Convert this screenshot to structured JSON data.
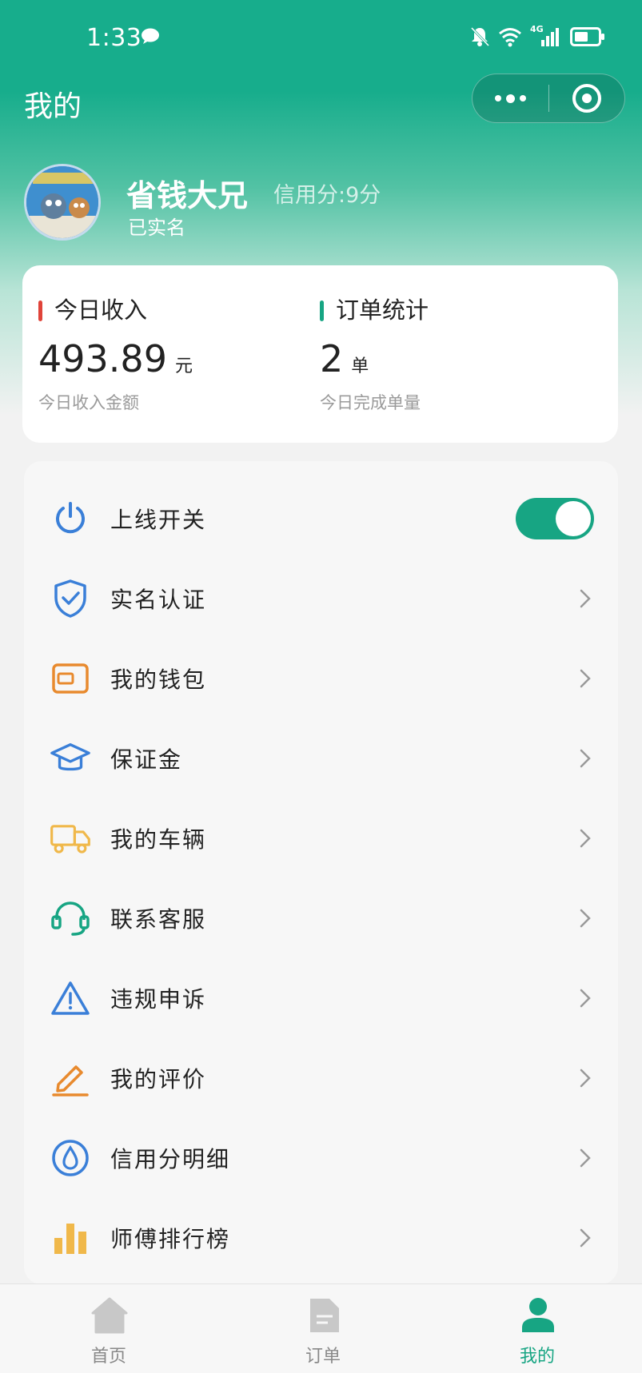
{
  "status_bar": {
    "time": "1:33",
    "network": "4G"
  },
  "nav": {
    "title": "我的"
  },
  "user": {
    "name": "省钱大兄",
    "credit": "信用分:9分",
    "status": "已实名"
  },
  "stats": {
    "income": {
      "title": "今日收入",
      "value": "493.89",
      "unit": "元",
      "sub": "今日收入金额",
      "bar_color": "#e0443a"
    },
    "orders": {
      "title": "订单统计",
      "value": "2",
      "unit": "单",
      "sub": "今日完成单量",
      "bar_color": "#17a583"
    }
  },
  "menu": {
    "items": [
      {
        "label": "上线开关",
        "icon": "power-icon",
        "toggle_on": true
      },
      {
        "label": "实名认证",
        "icon": "shield-check-icon"
      },
      {
        "label": "我的钱包",
        "icon": "wallet-icon"
      },
      {
        "label": "保证金",
        "icon": "graduation-cap-icon"
      },
      {
        "label": "我的车辆",
        "icon": "truck-icon"
      },
      {
        "label": "联系客服",
        "icon": "headset-icon"
      },
      {
        "label": "违规申诉",
        "icon": "warning-icon"
      },
      {
        "label": "我的评价",
        "icon": "edit-icon"
      },
      {
        "label": "信用分明细",
        "icon": "drop-icon"
      },
      {
        "label": "师傅排行榜",
        "icon": "bar-chart-icon"
      }
    ]
  },
  "tabbar": {
    "tabs": [
      {
        "label": "首页",
        "icon": "home-icon"
      },
      {
        "label": "订单",
        "icon": "document-icon"
      },
      {
        "label": "我的",
        "icon": "user-icon",
        "active": true
      }
    ]
  },
  "colors": {
    "brand": "#17ad8c",
    "accent_orange": "#e88a2e",
    "icon_blue": "#3a7fd8",
    "icon_yellow": "#f0b84a"
  }
}
